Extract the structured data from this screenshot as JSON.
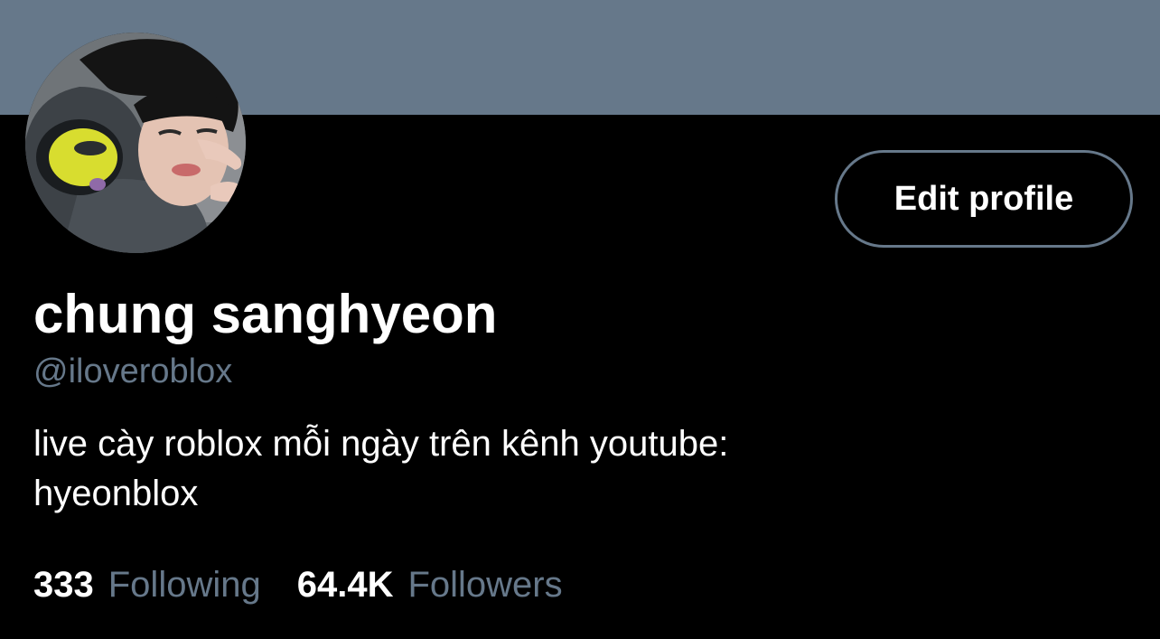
{
  "profile": {
    "display_name": "chung sanghyeon",
    "handle": "@iloveroblox",
    "bio_lines": [
      "live cày roblox mỗi ngày trên kênh youtube:",
      "hyeonblox"
    ],
    "edit_button_label": "Edit profile"
  },
  "stats": {
    "following_count": "333",
    "following_label": "Following",
    "followers_count": "64.4K",
    "followers_label": "Followers"
  },
  "colors": {
    "banner": "#66788a",
    "background": "#000000",
    "text_primary": "#ffffff",
    "text_secondary": "#66788a"
  }
}
